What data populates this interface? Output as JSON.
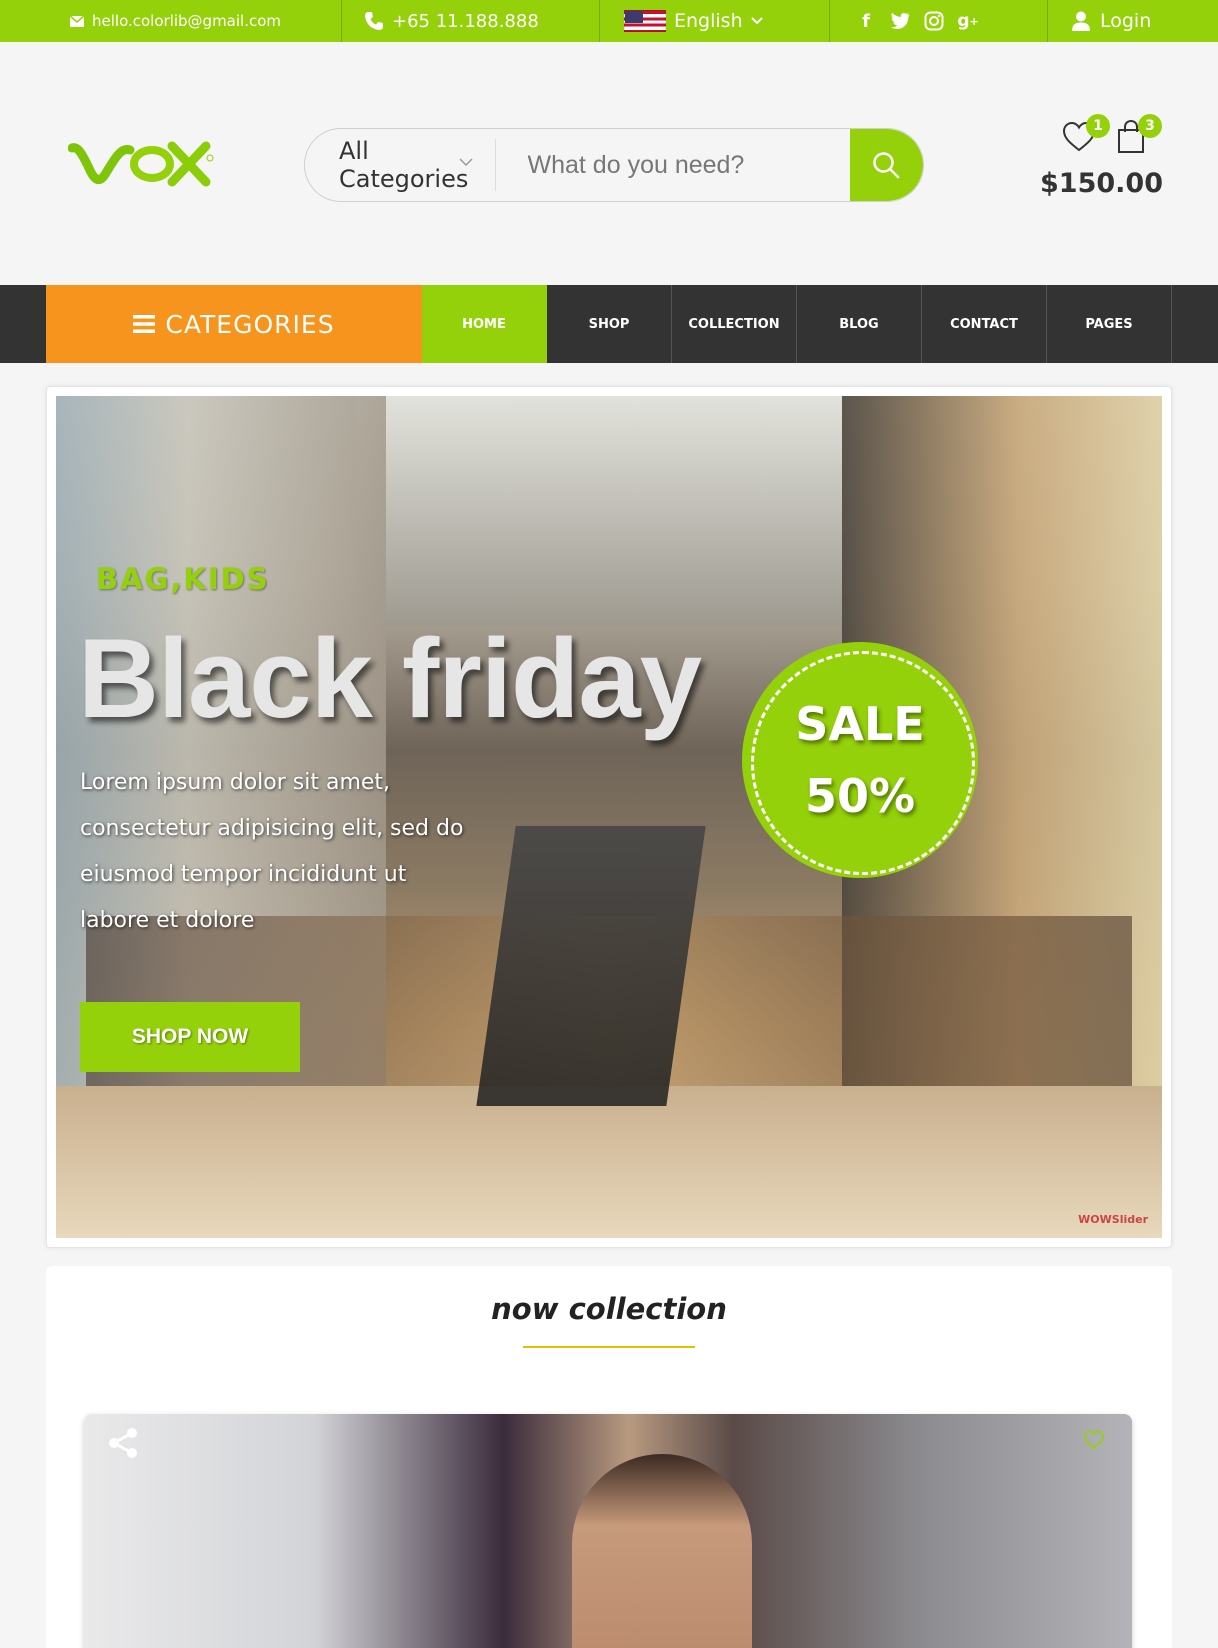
{
  "topbar": {
    "email": "hello.colorlib@gmail.com",
    "phone": "+65 11.188.888",
    "language": "English",
    "login": "Login",
    "social": [
      "facebook-icon",
      "twitter-icon",
      "instagram-icon",
      "google-plus-icon"
    ]
  },
  "header": {
    "logo": "vox",
    "search": {
      "category": "All Categories",
      "placeholder": "What do you need?"
    },
    "wishlist_count": "1",
    "cart_count": "3",
    "cart_total": "$150.00"
  },
  "nav": {
    "categories_label": "CATEGORIES",
    "items": [
      {
        "label": "HOME",
        "active": true
      },
      {
        "label": "SHOP",
        "active": false
      },
      {
        "label": "COLLECTION",
        "active": false
      },
      {
        "label": "BLOG",
        "active": false
      },
      {
        "label": "CONTACT",
        "active": false
      },
      {
        "label": "PAGES",
        "active": false
      }
    ]
  },
  "slider": {
    "tag": "BAG,KIDS",
    "title": "Black friday",
    "text": "Lorem ipsum dolor sit amet, consectetur adipisicing elit, sed do eiusmod tempor incididunt ut labore et dolore",
    "button": "SHOP NOW",
    "sale_line1": "SALE",
    "sale_line2": "50%",
    "watermark": "WOWSlider"
  },
  "collection": {
    "title": "now collection"
  },
  "colors": {
    "accent": "#94d10a",
    "categories_bg": "#f7941d",
    "nav_bg": "#333333"
  }
}
